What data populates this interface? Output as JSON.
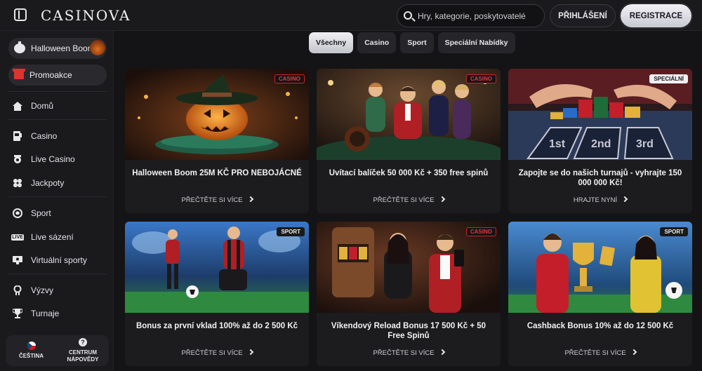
{
  "header": {
    "logo": "CASINOVA",
    "search_placeholder": "Hry, kategorie, poskytovatelé",
    "login_label": "PŘIHLÁŠENÍ",
    "register_label": "REGISTRACE"
  },
  "sidebar": {
    "promos": [
      {
        "label": "Halloween Boom",
        "icon": "pumpkin-icon"
      },
      {
        "label": "Promoakce",
        "icon": "gift-icon"
      }
    ],
    "items": [
      {
        "label": "Domů",
        "icon": "home-icon"
      },
      {
        "label": "Casino",
        "icon": "slot-machine-icon"
      },
      {
        "label": "Live Casino",
        "icon": "live-casino-icon"
      },
      {
        "label": "Jackpoty",
        "icon": "clover-icon"
      },
      {
        "label": "Sport",
        "icon": "soccer-ball-icon"
      },
      {
        "label": "Live sázení",
        "icon": "live-badge-icon"
      },
      {
        "label": "Virtuální sporty",
        "icon": "virtual-screen-icon"
      },
      {
        "label": "Výzvy",
        "icon": "medal-icon"
      },
      {
        "label": "Turnaje",
        "icon": "trophy-icon"
      }
    ],
    "language_label": "ČEŠTINA",
    "help_label_1": "CENTRUM",
    "help_label_2": "NÁPOVĚDY"
  },
  "filters": [
    "Všechny",
    "Casino",
    "Sport",
    "Speciální Nabídky"
  ],
  "cards": [
    {
      "title": "Halloween Boom 25M KČ PRO NEBOJÁCNÉ",
      "cta": "PŘEČTĚTE SI VÍCE",
      "badge": "CASINO",
      "image": "halloween-pumpkin"
    },
    {
      "title": "Uvítací balíček 50 000 Kč + 350 free spinů",
      "cta": "PŘEČTĚTE SI VÍCE",
      "badge": "CASINO",
      "image": "casino-roulette-party"
    },
    {
      "title": "Zapojte se do našich turnajů - vyhrajte 150 000 000 Kč!",
      "cta": "HRAJTE NYNÍ",
      "badge": "SPECIÁLNÍ",
      "image": "poker-chips-table"
    },
    {
      "title": "Bonus za první vklad 100% až do 2 500 Kč",
      "cta": "PŘEČTĚTE SI VÍCE",
      "badge": "SPORT",
      "image": "football-players"
    },
    {
      "title": "Víkendový Reload Bonus 17 500 Kč + 50 Free Spinů",
      "cta": "PŘEČTĚTE SI VÍCE",
      "badge": "CASINO",
      "image": "slot-machine-couple"
    },
    {
      "title": "Cashback Bonus 10% až do 12 500 Kč",
      "cta": "PŘEČTĚTE SI VÍCE",
      "badge": "SPORT",
      "image": "trophy-celebration"
    }
  ],
  "colors": {
    "background": "#141416",
    "panel": "#1a1a1d",
    "card": "#1c1c1f",
    "accent_red": "#e33b41"
  }
}
